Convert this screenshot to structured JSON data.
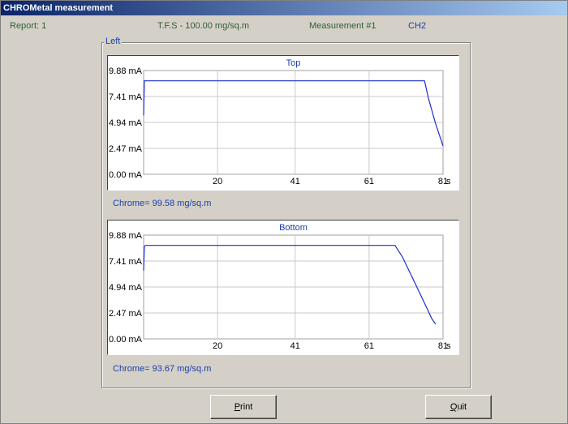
{
  "window": {
    "title": "CHROMetal measurement"
  },
  "info": {
    "report": "Report: 1",
    "tfs": "T.F.S - 100.00 mg/sq.m",
    "measurement": "Measurement #1",
    "channel": "CH2"
  },
  "group": {
    "label": "Left"
  },
  "charts": [
    {
      "title": "Top",
      "chrome": "Chrome= 99.58 mg/sq.m"
    },
    {
      "title": "Bottom",
      "chrome": "Chrome= 93.67 mg/sq.m"
    }
  ],
  "buttons": {
    "print": {
      "first": "P",
      "rest": "rint"
    },
    "quit": {
      "first": "Q",
      "rest": "uit"
    }
  },
  "colors": {
    "series": "#1a2fd0",
    "grid": "#c8c8c8",
    "title_blue": "#1a3fa8"
  },
  "chart_data": [
    {
      "type": "line",
      "title": "Top",
      "ylim": [
        0,
        9.88
      ],
      "xlim": [
        0,
        81
      ],
      "y_ticks": [
        "9.88 mA",
        "7.41 mA",
        "4.94 mA",
        "2.47 mA",
        "0.00 mA"
      ],
      "x_ticks": [
        "20",
        "41",
        "61",
        "81"
      ],
      "x_unit": "s",
      "grid": true,
      "series": [
        {
          "x": [
            0,
            0.2,
            0.4,
            5,
            20,
            41,
            61,
            76,
            77,
            79,
            81
          ],
          "y": [
            5.6,
            8.9,
            8.9,
            8.9,
            8.9,
            8.9,
            8.9,
            8.9,
            7.3,
            4.8,
            2.7
          ]
        }
      ]
    },
    {
      "type": "line",
      "title": "Bottom",
      "ylim": [
        0,
        9.88
      ],
      "xlim": [
        0,
        81
      ],
      "y_ticks": [
        "9.88 mA",
        "7.41 mA",
        "4.94 mA",
        "2.47 mA",
        "0.00 mA"
      ],
      "x_ticks": [
        "20",
        "41",
        "61",
        "81"
      ],
      "x_unit": "s",
      "grid": true,
      "series": [
        {
          "x": [
            0,
            0.2,
            0.5,
            10,
            30,
            50,
            68,
            70,
            73,
            76,
            78,
            79
          ],
          "y": [
            6.5,
            8.8,
            8.9,
            8.9,
            8.9,
            8.9,
            8.9,
            7.8,
            5.6,
            3.4,
            1.9,
            1.4
          ]
        }
      ]
    }
  ]
}
